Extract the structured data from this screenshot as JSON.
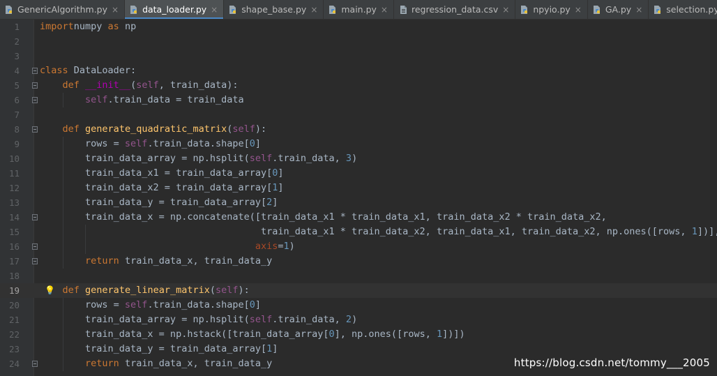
{
  "tabs": [
    {
      "label": "GenericAlgorithm.py",
      "icon": "python-file-icon",
      "active": false
    },
    {
      "label": "data_loader.py",
      "icon": "python-file-icon",
      "active": true
    },
    {
      "label": "shape_base.py",
      "icon": "python-file-icon",
      "active": false
    },
    {
      "label": "main.py",
      "icon": "python-file-icon",
      "active": false
    },
    {
      "label": "regression_data.csv",
      "icon": "csv-file-icon",
      "active": false
    },
    {
      "label": "npyio.py",
      "icon": "python-file-icon",
      "active": false
    },
    {
      "label": "GA.py",
      "icon": "python-file-icon",
      "active": false
    },
    {
      "label": "selection.py",
      "icon": "python-file-icon",
      "active": false
    }
  ],
  "close_glyph": "×",
  "current_line": 19,
  "colors": {
    "keyword": "#cc7832",
    "function": "#ffc66d",
    "self": "#94558d",
    "number": "#6897bb",
    "magic": "#b200b2",
    "kwarg": "#aa4926",
    "text": "#a9b7c6"
  },
  "lines": [
    {
      "n": "1",
      "tokens": [
        [
          "kw",
          "import"
        ],
        [
          "",
          "numpy"
        ],
        [
          "kw",
          " as"
        ],
        [
          "",
          " np"
        ]
      ]
    },
    {
      "n": "2",
      "tokens": []
    },
    {
      "n": "3",
      "tokens": []
    },
    {
      "n": "4",
      "tokens": [
        [
          "kw",
          "class"
        ],
        [
          "",
          " DataLoader:"
        ]
      ],
      "fold": true
    },
    {
      "n": "5",
      "tokens": [
        [
          "",
          "    "
        ],
        [
          "kw",
          "def"
        ],
        [
          "",
          " "
        ],
        [
          "magic",
          "__init__"
        ],
        [
          "",
          "("
        ],
        [
          "slf",
          "self"
        ],
        [
          "",
          ", train_data):"
        ]
      ],
      "fold": true
    },
    {
      "n": "6",
      "tokens": [
        [
          "",
          "        "
        ],
        [
          "slf",
          "self"
        ],
        [
          "",
          ".train_data = train_data"
        ]
      ],
      "fold": true
    },
    {
      "n": "7",
      "tokens": []
    },
    {
      "n": "8",
      "tokens": [
        [
          "",
          "    "
        ],
        [
          "kw",
          "def"
        ],
        [
          "",
          " "
        ],
        [
          "fn",
          "generate_quadratic_matrix"
        ],
        [
          "",
          "("
        ],
        [
          "slf",
          "self"
        ],
        [
          "",
          "):"
        ]
      ],
      "fold": true
    },
    {
      "n": "9",
      "tokens": [
        [
          "",
          "        rows = "
        ],
        [
          "slf",
          "self"
        ],
        [
          "",
          ".train_data.shape["
        ],
        [
          "num",
          "0"
        ],
        [
          "",
          "]"
        ]
      ]
    },
    {
      "n": "10",
      "tokens": [
        [
          "",
          "        train_data_array = np.hsplit("
        ],
        [
          "slf",
          "self"
        ],
        [
          "",
          ".train_data, "
        ],
        [
          "num",
          "3"
        ],
        [
          "",
          ")"
        ]
      ]
    },
    {
      "n": "11",
      "tokens": [
        [
          "",
          "        train_data_x1 = train_data_array["
        ],
        [
          "num",
          "0"
        ],
        [
          "",
          "]"
        ]
      ]
    },
    {
      "n": "12",
      "tokens": [
        [
          "",
          "        train_data_x2 = train_data_array["
        ],
        [
          "num",
          "1"
        ],
        [
          "",
          "]"
        ]
      ]
    },
    {
      "n": "13",
      "tokens": [
        [
          "",
          "        train_data_y = train_data_array["
        ],
        [
          "num",
          "2"
        ],
        [
          "",
          "]"
        ]
      ]
    },
    {
      "n": "14",
      "tokens": [
        [
          "",
          "        train_data_x = np.concatenate([train_data_x1 * train_data_x1, train_data_x2 * train_data_x2,"
        ]
      ],
      "fold": true
    },
    {
      "n": "15",
      "tokens": [
        [
          "",
          "                                       train_data_x1 * train_data_x2, train_data_x1, train_data_x2, np.ones([rows, "
        ],
        [
          "num",
          "1"
        ],
        [
          "",
          "])],"
        ]
      ]
    },
    {
      "n": "16",
      "tokens": [
        [
          "",
          "                                      "
        ],
        [
          "arg",
          "axis"
        ],
        [
          "",
          "="
        ],
        [
          "num",
          "1"
        ],
        [
          "",
          ")"
        ]
      ],
      "fold": true
    },
    {
      "n": "17",
      "tokens": [
        [
          "",
          "        "
        ],
        [
          "kw",
          "return"
        ],
        [
          "",
          " train_data_x, train_data_y"
        ]
      ],
      "fold": true
    },
    {
      "n": "18",
      "tokens": []
    },
    {
      "n": "19",
      "tokens": [
        [
          "",
          "    "
        ],
        [
          "kw",
          "def"
        ],
        [
          "",
          " "
        ],
        [
          "fn",
          "generate_linear_matrix"
        ],
        [
          "",
          "("
        ],
        [
          "slf",
          "self"
        ],
        [
          "",
          "):"
        ]
      ],
      "bulb": true
    },
    {
      "n": "20",
      "tokens": [
        [
          "",
          "        rows = "
        ],
        [
          "slf",
          "self"
        ],
        [
          "",
          ".train_data.shape["
        ],
        [
          "num",
          "0"
        ],
        [
          "",
          "]"
        ]
      ]
    },
    {
      "n": "21",
      "tokens": [
        [
          "",
          "        train_data_array = np.hsplit("
        ],
        [
          "slf",
          "self"
        ],
        [
          "",
          ".train_data, "
        ],
        [
          "num",
          "2"
        ],
        [
          "",
          ")"
        ]
      ]
    },
    {
      "n": "22",
      "tokens": [
        [
          "",
          "        train_data_x = np.hstack([train_data_array["
        ],
        [
          "num",
          "0"
        ],
        [
          "",
          "], np.ones([rows, "
        ],
        [
          "num",
          "1"
        ],
        [
          "",
          "])])"
        ]
      ]
    },
    {
      "n": "23",
      "tokens": [
        [
          "",
          "        train_data_y = train_data_array["
        ],
        [
          "num",
          "1"
        ],
        [
          "",
          "]"
        ]
      ]
    },
    {
      "n": "24",
      "tokens": [
        [
          "",
          "        "
        ],
        [
          "kw",
          "return"
        ],
        [
          "",
          " train_data_x, train_data_y"
        ]
      ],
      "fold": true
    }
  ],
  "watermark": "https://blog.csdn.net/tommy___2005"
}
